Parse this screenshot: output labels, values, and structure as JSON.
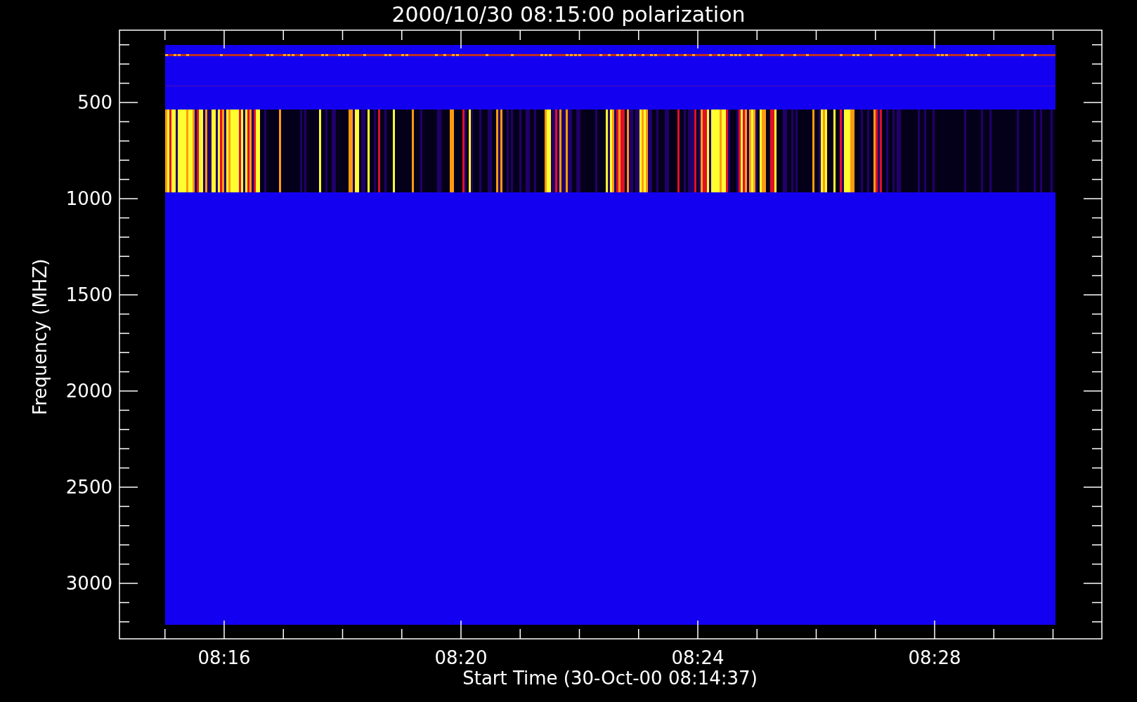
{
  "plot": {
    "title": "2000/10/30 08:15:00 polarization",
    "y_axis": {
      "label": "Frequency (MHZ)",
      "ticks": [
        "500",
        "1000",
        "1500",
        "2000",
        "2500",
        "3000"
      ]
    },
    "x_axis": {
      "label": "Start Time (30-Oct-00 08:14:37)",
      "ticks": [
        "08:16",
        "08:20",
        "08:24",
        "08:28"
      ]
    }
  }
}
